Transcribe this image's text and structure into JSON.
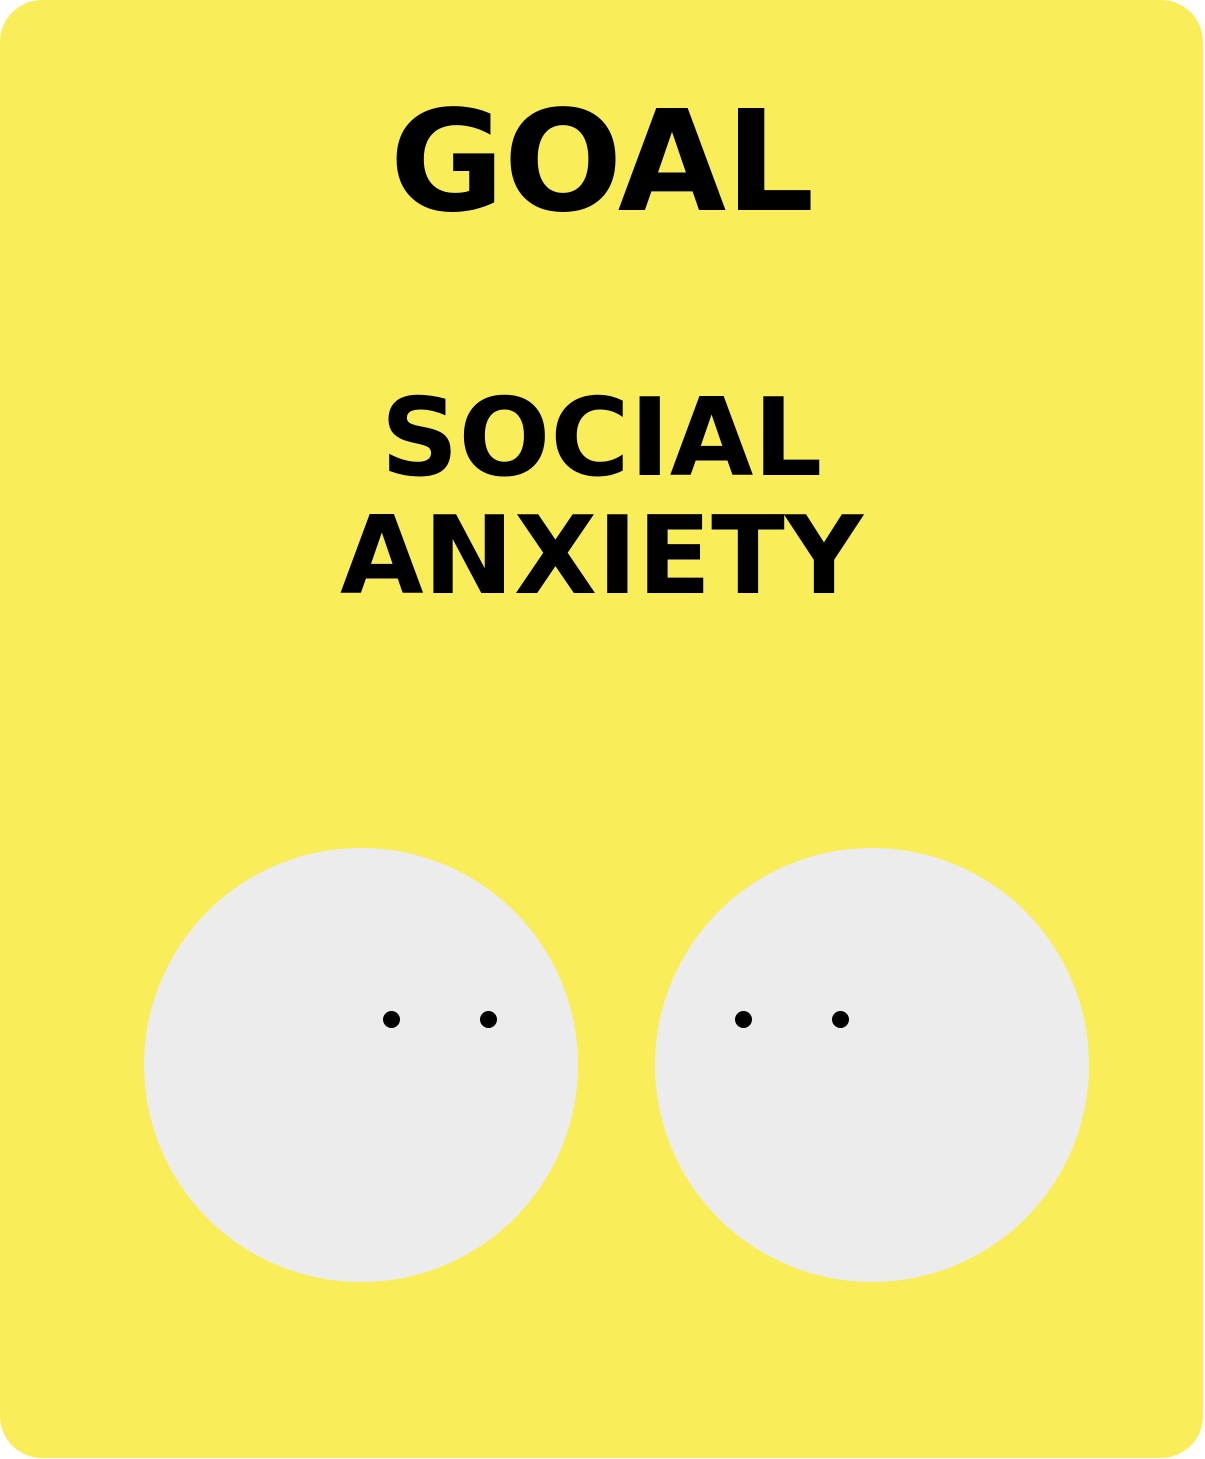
{
  "card": {
    "background_color": "#f9ee5a",
    "title": "GOAL",
    "subtitle_lines": [
      "SOCIAL",
      "ANXIETY"
    ]
  },
  "faces": [
    {
      "icon": "face-icon",
      "color": "#ececec"
    },
    {
      "icon": "face-icon",
      "color": "#ececec"
    }
  ]
}
